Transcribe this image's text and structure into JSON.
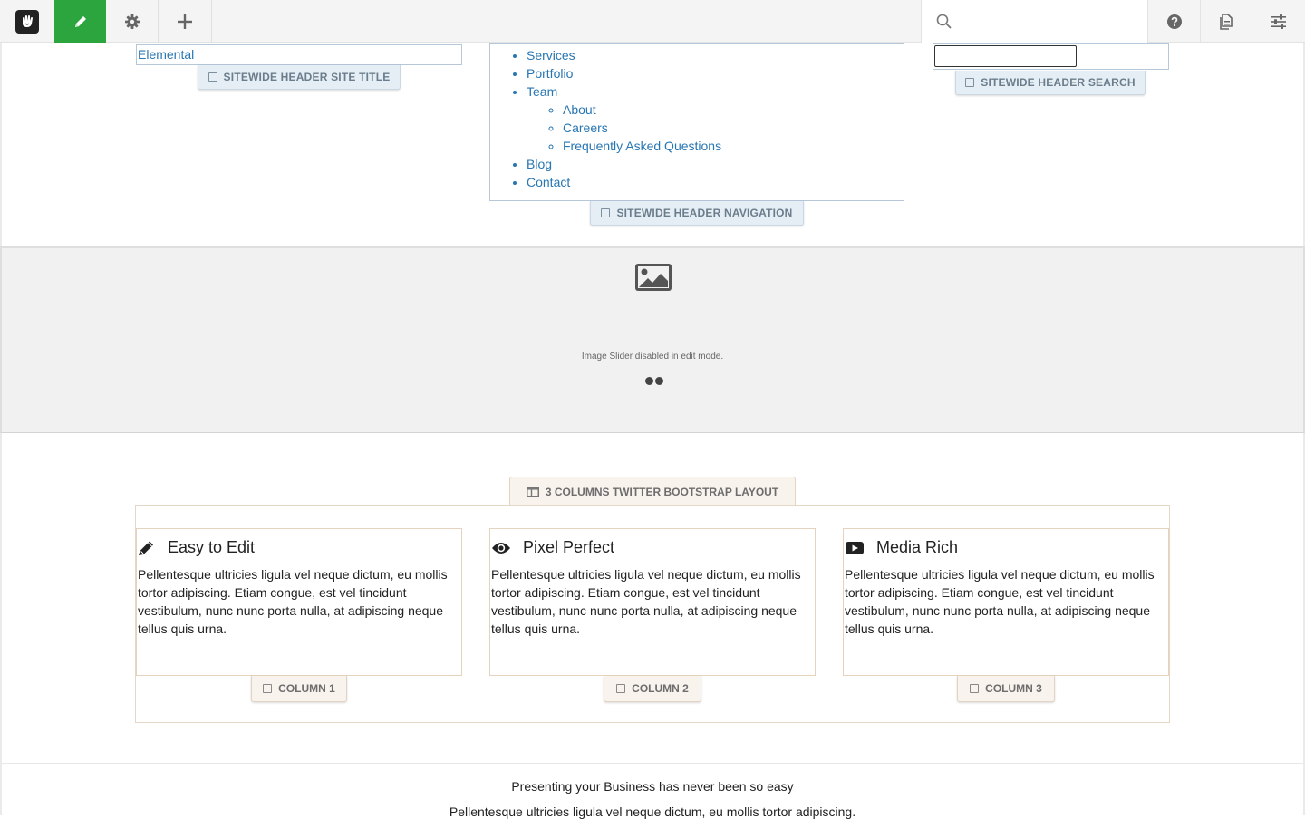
{
  "toolbar": {
    "search": {
      "placeholder": "",
      "value": ""
    },
    "colors": {
      "edit_active": "#2da53e",
      "background": "#f4f4f4"
    },
    "icons": [
      "concrete5-logo-icon",
      "pencil-icon",
      "gear-icon",
      "plus-icon",
      "search-icon",
      "help-icon",
      "pages-icon",
      "sliders-icon"
    ]
  },
  "header": {
    "site_title": {
      "text": "Elemental",
      "label": "SITEWIDE HEADER SITE TITLE"
    },
    "navigation": {
      "label": "SITEWIDE HEADER NAVIGATION",
      "items": [
        {
          "label": "Services"
        },
        {
          "label": "Portfolio"
        },
        {
          "label": "Team",
          "children": [
            {
              "label": "About"
            },
            {
              "label": "Careers"
            },
            {
              "label": "Frequently Asked Questions"
            }
          ]
        },
        {
          "label": "Blog"
        },
        {
          "label": "Contact"
        }
      ]
    },
    "search": {
      "label": "SITEWIDE HEADER SEARCH",
      "value": ""
    }
  },
  "slider": {
    "message": "Image Slider disabled in edit mode.",
    "icon": "image-icon",
    "dot_count": 2
  },
  "layout": {
    "label": "3 COLUMNS TWITTER BOOTSTRAP LAYOUT",
    "columns": [
      {
        "icon": "pencil-icon",
        "title": "Easy to Edit",
        "text": "Pellentesque ultricies ligula vel neque dictum, eu mollis tortor adipiscing. Etiam congue, est vel tincidunt vestibulum, nunc nunc porta nulla, at adipiscing neque tellus quis urna.",
        "label": "COLUMN 1"
      },
      {
        "icon": "eye-icon",
        "title": "Pixel Perfect",
        "text": "Pellentesque ultricies ligula vel neque dictum, eu mollis tortor adipiscing. Etiam congue, est vel tincidunt vestibulum, nunc nunc porta nulla, at adipiscing neque tellus quis urna.",
        "label": "COLUMN 2"
      },
      {
        "icon": "youtube-icon",
        "title": "Media Rich",
        "text": "Pellentesque ultricies ligula vel neque dictum, eu mollis tortor adipiscing. Etiam congue, est vel tincidunt vestibulum, nunc nunc porta nulla, at adipiscing neque tellus quis urna.",
        "label": "COLUMN 3"
      }
    ]
  },
  "promo": {
    "title": "Presenting your Business has never been so easy",
    "text": "Pellentesque ultricies ligula vel neque dictum, eu mollis tortor adipiscing."
  }
}
